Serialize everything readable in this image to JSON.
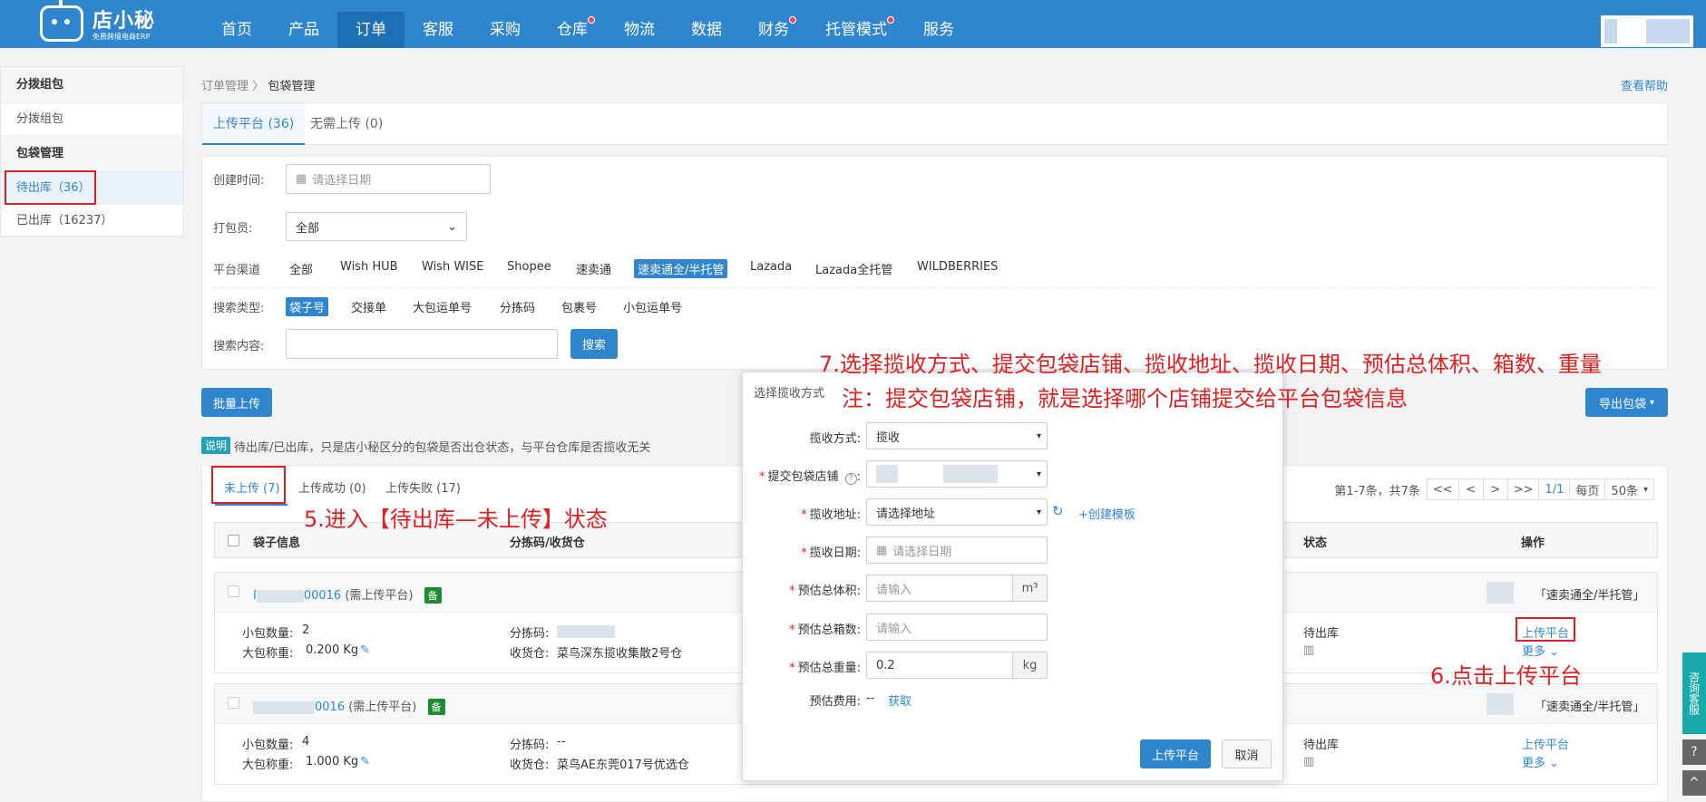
{
  "header": {
    "logo_main": "店小秘",
    "logo_sub": "免费跨境电商ERP",
    "nav": [
      {
        "label": "首页",
        "dot": false
      },
      {
        "label": "产品",
        "dot": false
      },
      {
        "label": "订单",
        "dot": false,
        "active": true
      },
      {
        "label": "客服",
        "dot": false
      },
      {
        "label": "采购",
        "dot": false
      },
      {
        "label": "仓库",
        "dot": true
      },
      {
        "label": "物流",
        "dot": false
      },
      {
        "label": "数据",
        "dot": false
      },
      {
        "label": "财务",
        "dot": true
      },
      {
        "label": "托管模式",
        "dot": true
      },
      {
        "label": "服务",
        "dot": false
      }
    ]
  },
  "sidebar": {
    "sec1": "分拨组包",
    "item1": "分拨组包",
    "sec2": "包袋管理",
    "item_pending": "待出库（36）",
    "item_out": "已出库（16237）"
  },
  "breadcrumb": {
    "parent": "订单管理",
    "sep": "〉",
    "current": "包袋管理"
  },
  "help_link": "查看帮助",
  "top_tabs": {
    "upload": "上传平台 (36)",
    "no_upload": "无需上传 (0)"
  },
  "filters": {
    "created_label": "创建时间:",
    "date_placeholder": "请选择日期",
    "packer_label": "打包员:",
    "packer_value": "全部",
    "channel_label": "平台渠道",
    "channels": [
      "全部",
      "Wish HUB",
      "Wish WISE",
      "Shopee",
      "速卖通",
      "速卖通全/半托管",
      "Lazada",
      "Lazada全托管",
      "WILDBERRIES"
    ],
    "search_type_label": "搜索类型:",
    "search_types": [
      "袋子号",
      "交接单",
      "大包运单号",
      "分拣码",
      "包裹号",
      "小包运单号"
    ],
    "search_content_label": "搜索内容:",
    "search_button": "搜索"
  },
  "batch_upload": "批量上传",
  "export_button": "导出包袋",
  "note": {
    "tag": "说明",
    "text": "待出库/已出库，只是店小秘区分的包袋是否出仓状态，与平台仓库是否揽收无关"
  },
  "list": {
    "tabs": {
      "not_uploaded": "未上传 (7)",
      "success": "上传成功 (0)",
      "failed": "上传失败 (17)"
    },
    "pager": {
      "summary": "第1-7条，共7条",
      "first": "<<",
      "prev": "<",
      "next": ">",
      "last": ">>",
      "page": "1/1",
      "per_page_label": "每页",
      "per_page": "50条"
    },
    "headers": {
      "bag_info": "袋子信息",
      "sort_code": "分拣码/收货仓",
      "status": "状态",
      "action": "操作"
    },
    "rows": [
      {
        "bag_no": "00016",
        "bag_prefix": "I",
        "need": "(需上传平台)",
        "bei": "备",
        "platform": "「速卖通全/半托管」",
        "qty_label": "小包数量:",
        "qty": "2",
        "weight_label": "大包称重:",
        "weight": "0.200 Kg",
        "sort_label": "分拣码:",
        "sort_value": "",
        "wh_label": "收货仓:",
        "wh_value": "菜鸟深东揽收集散2号仓",
        "status": "待出库",
        "action_upload": "上传平台",
        "action_more": "更多"
      },
      {
        "bag_no": "0016",
        "bag_prefix": "",
        "need": "(需上传平台)",
        "bei": "备",
        "platform": "「速卖通全/半托管」",
        "qty_label": "小包数量:",
        "qty": "4",
        "weight_label": "大包称重:",
        "weight": "1.000 Kg",
        "sort_label": "分拣码:",
        "sort_value": "--",
        "wh_label": "收货仓:",
        "wh_value": "菜鸟AE东莞017号优选仓",
        "status": "待出库",
        "action_upload": "上传平台",
        "action_more": "更多"
      }
    ]
  },
  "modal": {
    "title": "选择揽收方式",
    "method_label": "揽收方式:",
    "method_value": "揽收",
    "shop_label": "提交包袋店铺",
    "address_label": "揽收地址:",
    "address_value": "请选择地址",
    "create_template": "+创建模板",
    "date_label": "揽收日期:",
    "date_placeholder": "请选择日期",
    "volume_label": "预估总体积:",
    "volume_placeholder": "请输入",
    "volume_unit": "m³",
    "boxes_label": "预估总箱数:",
    "boxes_placeholder": "请输入",
    "weight_label": "预估总重量:",
    "weight_value": "0.2",
    "weight_unit": "kg",
    "fee_label": "预估费用:",
    "fee_value": "--",
    "fee_link": "获取",
    "submit": "上传平台",
    "cancel": "取消"
  },
  "annotations": {
    "a5": "5.进入【待出库—未上传】状态",
    "a6": "6.点击上传平台",
    "a7": "7.选择揽收方式、提交包袋店铺、揽收地址、揽收日期、预估总体积、箱数、重量",
    "a7_note": "注：提交包袋店铺，就是选择哪个店铺提交给平台包袋信息"
  },
  "side_float": {
    "consult": "咨询客服",
    "help": "?",
    "top": "^"
  },
  "colors": {
    "primary": "#2f86cf",
    "annotation": "#e02020",
    "tag_green": "#1e8a32"
  }
}
